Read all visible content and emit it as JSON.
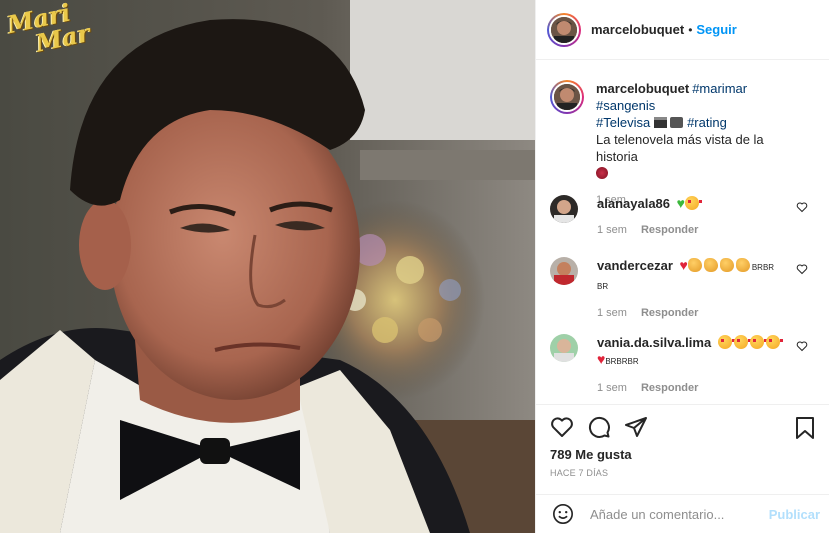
{
  "media": {
    "logo_line1": "Mari",
    "logo_line2": "Mar"
  },
  "header": {
    "username": "marcelobuquet",
    "separator": "•",
    "follow_label": "Seguir"
  },
  "caption": {
    "username": "marcelobuquet",
    "tags_line1": [
      "#marimar",
      "#sangenis"
    ],
    "tag_line2": "#Televisa",
    "tag_rating": "#rating",
    "text": "La telenovela más vista de la historia",
    "time": "1 sem"
  },
  "comments": [
    {
      "username": "alanayala86",
      "time": "1 sem",
      "reply": "Responder"
    },
    {
      "username": "vandercezar",
      "text_tail": "BRBR",
      "text_wrap": "BR",
      "time": "1 sem",
      "reply": "Responder"
    },
    {
      "username": "vania.da.silva.lima",
      "text_wrap": "BRBRBR",
      "time": "1 sem",
      "reply": "Responder"
    }
  ],
  "actions": {
    "likes": "789 Me gusta",
    "date": "HACE 7 DÍAS",
    "icons": [
      "heart-icon",
      "comment-icon",
      "share-icon",
      "bookmark-icon"
    ]
  },
  "add_comment": {
    "placeholder": "Añade un comentario...",
    "publish_label": "Publicar"
  },
  "colors": {
    "link_blue": "#0095f6",
    "tag_blue": "#00376b",
    "muted": "#8e8e8e",
    "publish_disabled": "#b2dffc"
  }
}
